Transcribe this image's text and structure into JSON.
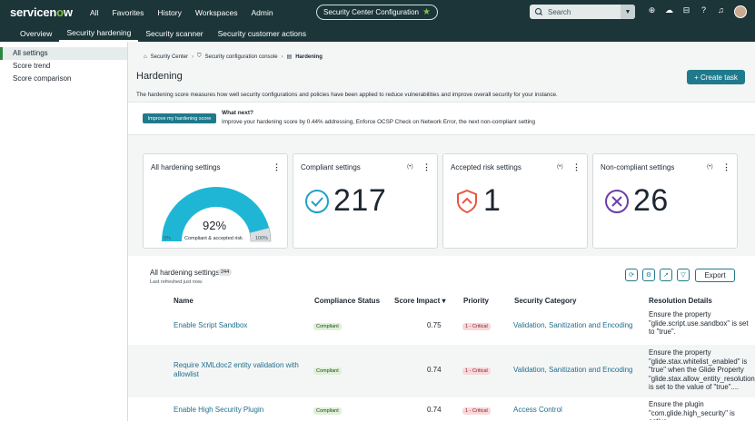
{
  "header": {
    "logo_text": "servicenow",
    "nav": [
      "All",
      "Favorites",
      "History",
      "Workspaces",
      "Admin"
    ],
    "app_pill": "Security Center Configuration",
    "search_placeholder": "Search"
  },
  "subnav": {
    "tabs": [
      "Overview",
      "Security hardening",
      "Security scanner",
      "Security customer actions"
    ],
    "active": "Security hardening"
  },
  "sidebar": {
    "items": [
      "All settings",
      "Score trend",
      "Score comparison"
    ],
    "active": "All settings"
  },
  "breadcrumb": [
    "Security Center",
    "Security configuration console",
    "Hardening"
  ],
  "page": {
    "title": "Hardening",
    "create_task": "+ Create task",
    "description": "The hardening score measures how well security configurations and policies have been applied to reduce vulnerabilities and improve overall security for your instance."
  },
  "what_next": {
    "button": "Improve my hardening score",
    "title": "What next?",
    "text": "Improve your hardening score by 0.44% addressing, Enforce OCSP Check on Network Error, the next non-compliant setting"
  },
  "cards": {
    "all": {
      "title": "All hardening settings",
      "percent": "92%",
      "percent_value": 92,
      "label": "Compliant & accepted risk",
      "min": "0%",
      "max": "100%"
    },
    "compliant": {
      "title": "Compliant settings",
      "value": "217"
    },
    "accepted": {
      "title": "Accepted risk settings",
      "value": "1"
    },
    "noncompliant": {
      "title": "Non-compliant settings",
      "value": "26"
    }
  },
  "table": {
    "title": "All hardening settings",
    "count": "244",
    "refreshed": "Last refreshed just now.",
    "export": "Export",
    "columns": [
      "Name",
      "Compliance Status",
      "Score Impact ▾",
      "Priority",
      "Security Category",
      "Resolution Details"
    ],
    "rows": [
      {
        "name": "Enable Script Sandbox",
        "status": "Compliant",
        "impact": "0.75",
        "priority": "1 - Critical",
        "category": "Validation, Sanitization and Encoding",
        "resolution": "Ensure the property \"glide.script.use.sandbox\" is set to \"true\"."
      },
      {
        "name": "Require XMLdoc2 entity validation with allowlist",
        "status": "Compliant",
        "impact": "0.74",
        "priority": "1 - Critical",
        "category": "Validation, Sanitization and Encoding",
        "resolution": "Ensure the property \"glide.stax.whitelist_enabled\" is \"true\" when the Glide Property \"glide.stax.allow_entity_resolution\" is set to the value of \"true\"...."
      },
      {
        "name": "Enable High Security Plugin",
        "status": "Compliant",
        "impact": "0.74",
        "priority": "1 - Critical",
        "category": "Access Control",
        "resolution": "Ensure the plugin \"com.glide.high_security\" is active."
      }
    ]
  },
  "colors": {
    "header_bg": "#1b3539",
    "accent": "#1f7a8c",
    "gauge": "#1fb6d6",
    "compliant_icon": "#1fa3c6",
    "risk_icon": "#e8573f",
    "noncompliant_icon": "#6b3fa8"
  }
}
